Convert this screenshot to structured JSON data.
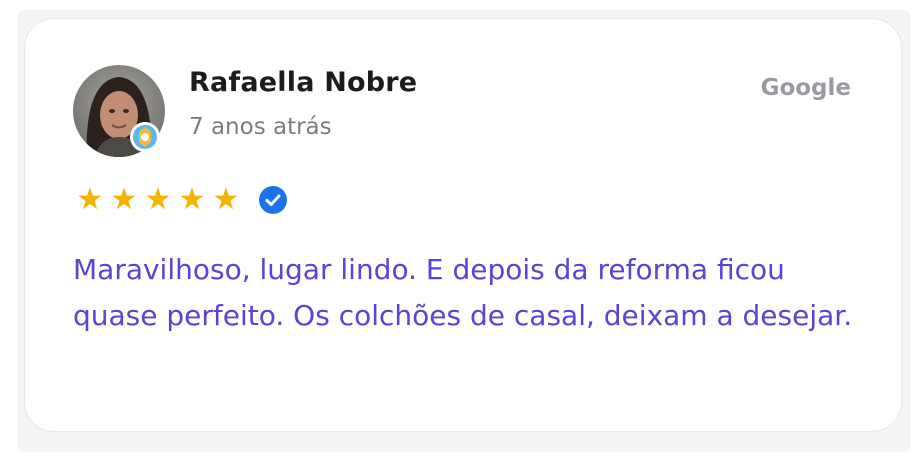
{
  "review": {
    "author": "Rafaella Nobre",
    "date": "7 anos atrás",
    "source": "Google",
    "rating": 5,
    "stars": [
      "★",
      "★",
      "★",
      "★",
      "★"
    ],
    "verified_icon": "verified-check-icon",
    "text": "Maravilhoso, lugar lindo. E depois da reforma ficou quase perfeito. Os colchões de casal, deixam a desejar."
  },
  "colors": {
    "star": "#f4b400",
    "verified": "#1a73e8",
    "review_text": "#5746d6",
    "author": "#1c1c1f",
    "date": "#7c7c84",
    "source": "#9a9aa2"
  }
}
